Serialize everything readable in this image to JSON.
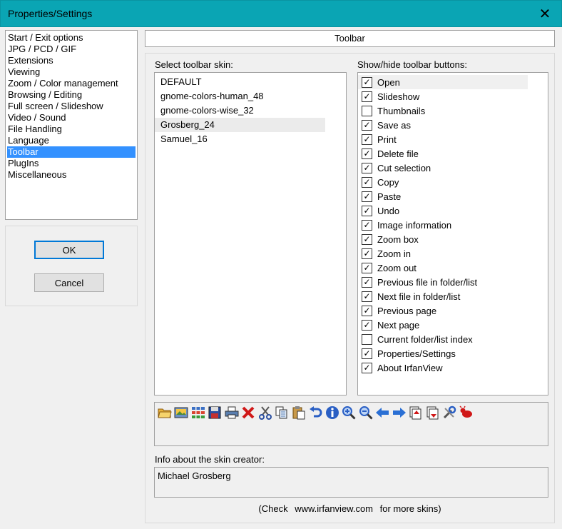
{
  "window": {
    "title": "Properties/Settings",
    "close_glyph": "✕"
  },
  "nav": {
    "items": [
      {
        "label": "Start / Exit options",
        "selected": false
      },
      {
        "label": "JPG / PCD / GIF",
        "selected": false
      },
      {
        "label": "Extensions",
        "selected": false
      },
      {
        "label": "Viewing",
        "selected": false
      },
      {
        "label": "Zoom / Color management",
        "selected": false
      },
      {
        "label": "Browsing / Editing",
        "selected": false
      },
      {
        "label": "Full screen / Slideshow",
        "selected": false
      },
      {
        "label": "Video / Sound",
        "selected": false
      },
      {
        "label": "File Handling",
        "selected": false
      },
      {
        "label": "Language",
        "selected": false
      },
      {
        "label": "Toolbar",
        "selected": true
      },
      {
        "label": "PlugIns",
        "selected": false
      },
      {
        "label": "Miscellaneous",
        "selected": false
      }
    ]
  },
  "buttons": {
    "ok": "OK",
    "cancel": "Cancel"
  },
  "panel": {
    "title": "Toolbar",
    "skin_label": "Select toolbar skin:",
    "skins": [
      "DEFAULT",
      "gnome-colors-human_48",
      "gnome-colors-wise_32",
      "Grosberg_24",
      "Samuel_16"
    ],
    "selected_skin": "Grosberg_24",
    "buttons_label": "Show/hide toolbar buttons:",
    "toolbar_buttons": [
      {
        "label": "Open",
        "checked": true
      },
      {
        "label": "Slideshow",
        "checked": true
      },
      {
        "label": "Thumbnails",
        "checked": false
      },
      {
        "label": "Save as",
        "checked": true
      },
      {
        "label": "Print",
        "checked": true
      },
      {
        "label": "Delete file",
        "checked": true
      },
      {
        "label": "Cut selection",
        "checked": true
      },
      {
        "label": "Copy",
        "checked": true
      },
      {
        "label": "Paste",
        "checked": true
      },
      {
        "label": "Undo",
        "checked": true
      },
      {
        "label": "Image information",
        "checked": true
      },
      {
        "label": "Zoom box",
        "checked": true
      },
      {
        "label": "Zoom in",
        "checked": true
      },
      {
        "label": "Zoom out",
        "checked": true
      },
      {
        "label": "Previous file in folder/list",
        "checked": true
      },
      {
        "label": "Next file in folder/list",
        "checked": true
      },
      {
        "label": "Previous page",
        "checked": true
      },
      {
        "label": "Next page",
        "checked": true
      },
      {
        "label": "Current folder/list index",
        "checked": false
      },
      {
        "label": "Properties/Settings",
        "checked": true
      },
      {
        "label": "About IrfanView",
        "checked": true
      }
    ],
    "preview_icons": [
      "open-folder-icon",
      "slideshow-icon",
      "thumbnails-icon",
      "save-icon",
      "print-icon",
      "delete-icon",
      "cut-icon",
      "copy-icon",
      "paste-icon",
      "undo-icon",
      "info-icon",
      "zoom-box-icon",
      "zoom-out-icon",
      "previous-file-icon",
      "next-file-icon",
      "previous-page-icon",
      "next-page-icon",
      "properties-icon",
      "about-icon"
    ],
    "info_label": "Info about the skin creator:",
    "info_value": "Michael Grosberg",
    "footer": {
      "prefix": "(Check",
      "link": "www.irfanview.com",
      "suffix": "for more skins)"
    }
  },
  "colors": {
    "titlebar": "#0aa5b4",
    "selection": "#3391ff",
    "focus_border": "#0078d7"
  }
}
